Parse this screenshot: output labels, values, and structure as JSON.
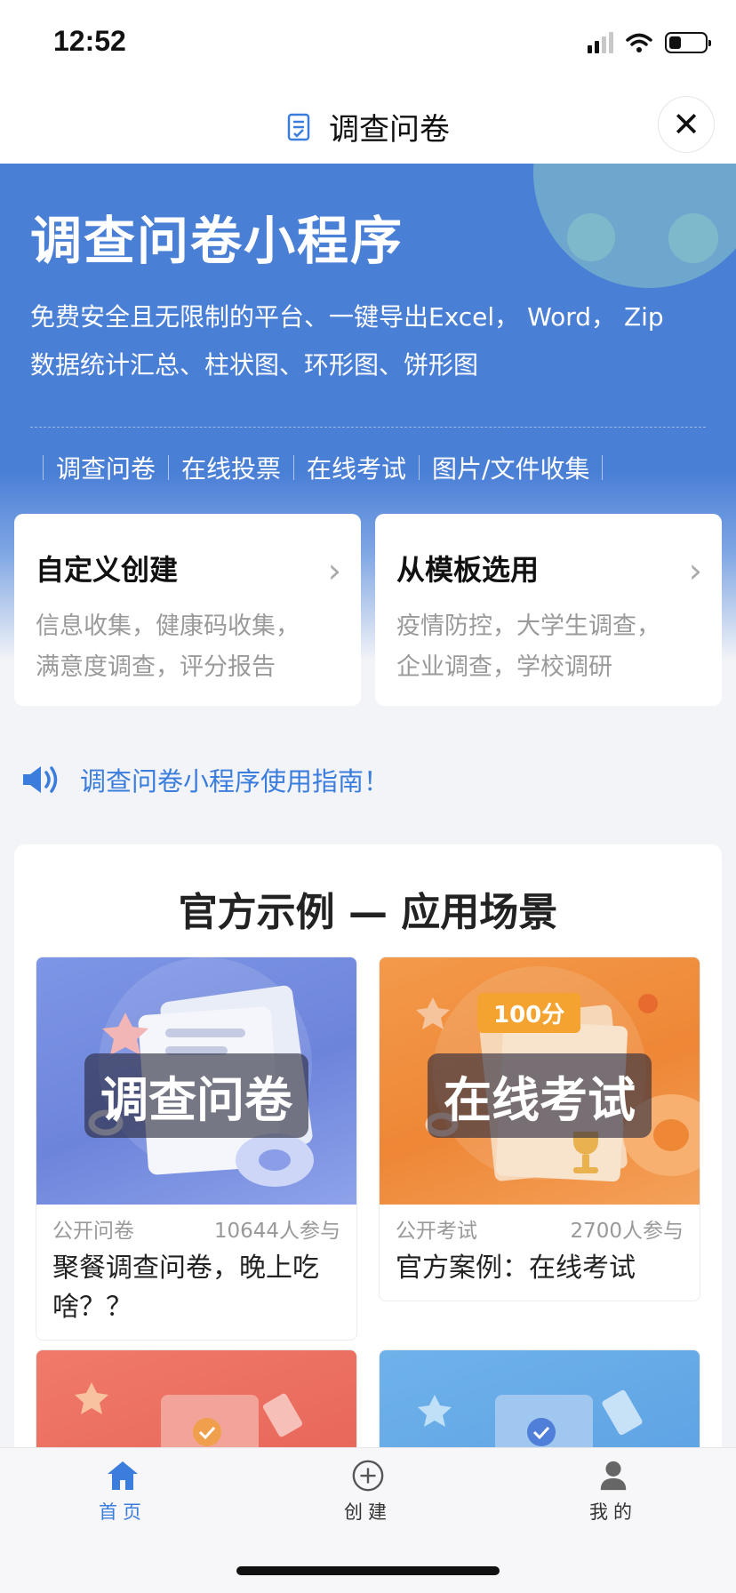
{
  "status_bar": {
    "time": "12:52"
  },
  "title_bar": {
    "title": "调查问卷",
    "close_symbol": "✕"
  },
  "hero": {
    "title": "调查问卷小程序",
    "description_line1": "免费安全且无限制的平台、一键导出Excel， Word， Zip",
    "description_line2": "数据统计汇总、柱状图、环形图、饼形图",
    "tags": [
      "调查问卷",
      "在线投票",
      "在线考试",
      "图片/文件收集"
    ]
  },
  "actions": [
    {
      "title": "自定义创建",
      "desc_line1": "信息收集，健康码收集，",
      "desc_line2": "满意度调查，评分报告"
    },
    {
      "title": "从模板选用",
      "desc_line1": "疫情防控，大学生调查，",
      "desc_line2": "企业调查，学校调研"
    }
  ],
  "notice": {
    "text": "调查问卷小程序使用指南！"
  },
  "showcase": {
    "title": "官方示例 — 应用场景",
    "cases": [
      {
        "cover_label": "调查问卷",
        "type": "公开问卷",
        "participants": "10644人参与",
        "title": "聚餐调查问卷，晚上吃啥？？"
      },
      {
        "cover_label": "在线考试",
        "badge": "100分",
        "type": "公开考试",
        "participants": "2700人参与",
        "title": "官方案例：在线考试"
      }
    ]
  },
  "tabbar": {
    "items": [
      {
        "label": "首页",
        "icon": "home-icon",
        "active": true
      },
      {
        "label": "创建",
        "icon": "plus-circle-icon",
        "active": false
      },
      {
        "label": "我的",
        "icon": "user-icon",
        "active": false
      }
    ]
  },
  "colors": {
    "accent": "#3b7ddd",
    "hero_blue": "#4a7fd6",
    "orange": "#f0893a"
  }
}
